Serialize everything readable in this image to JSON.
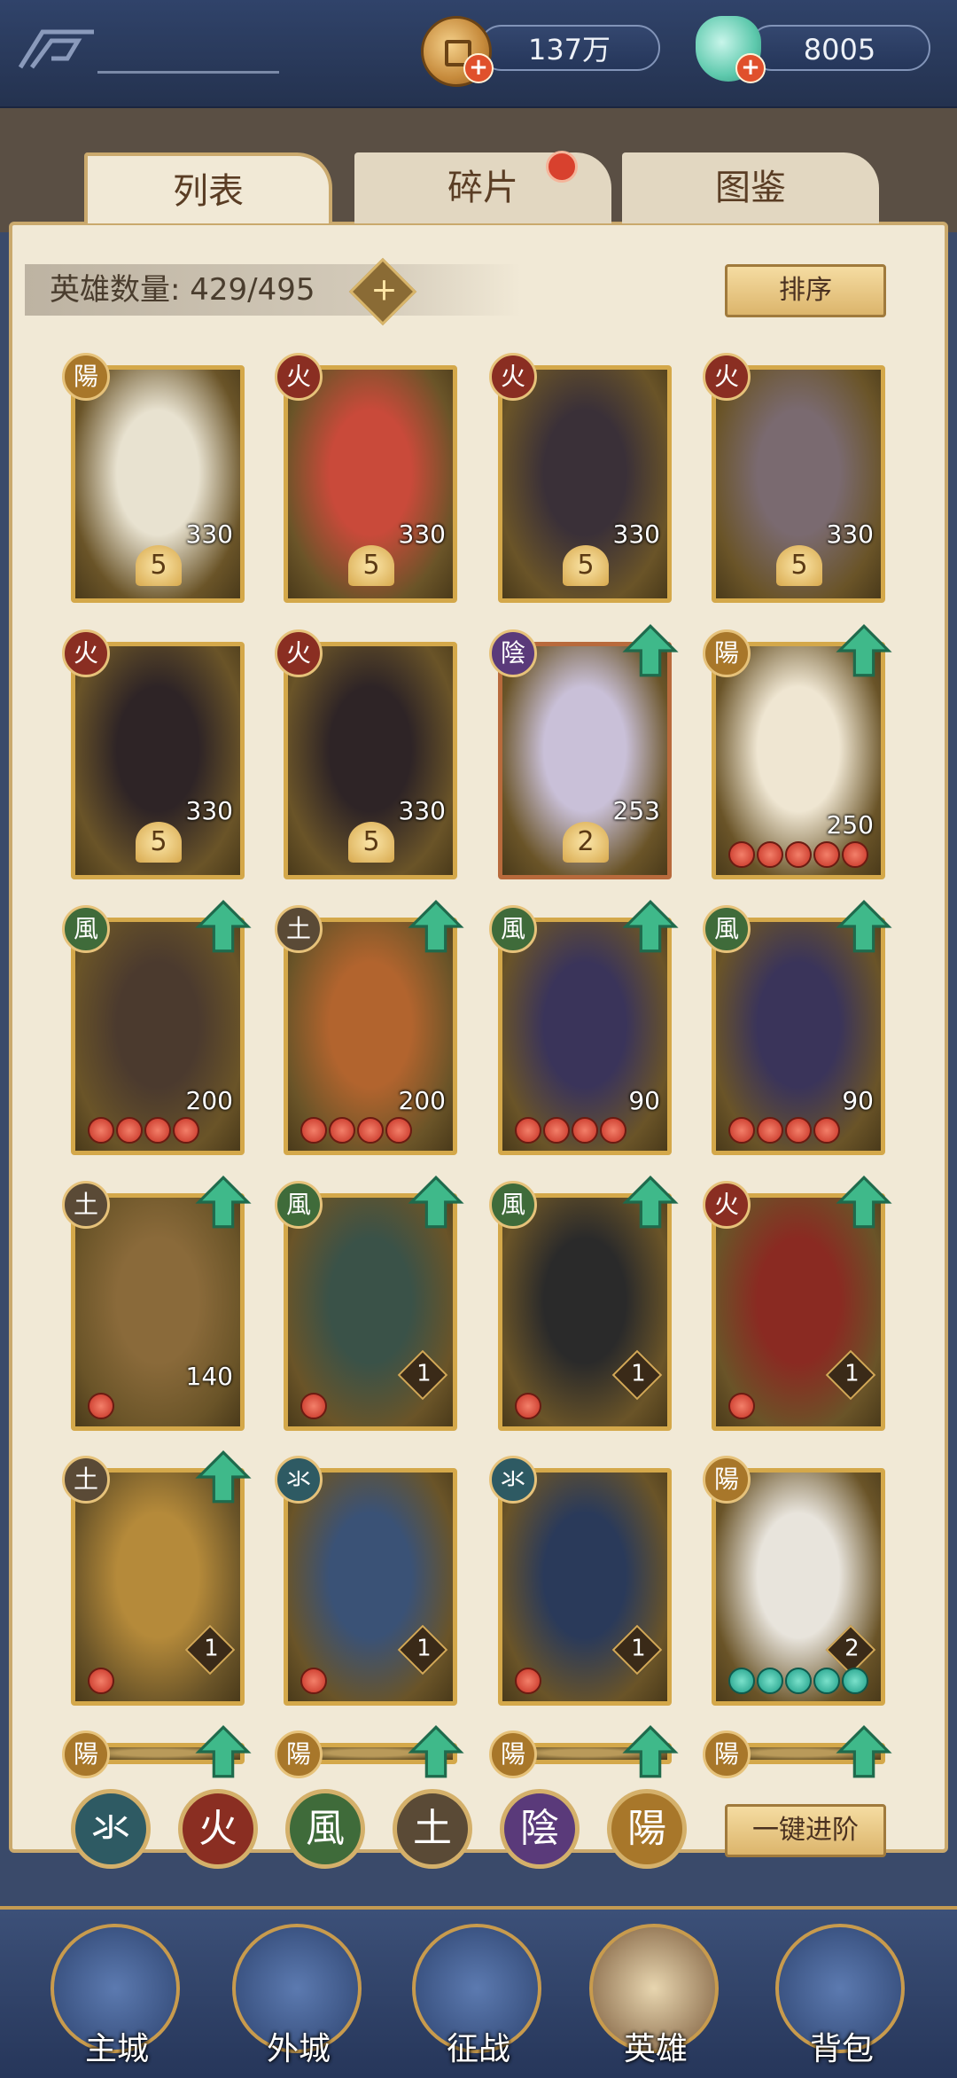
{
  "resources": {
    "coins": "137万",
    "jade": "8005"
  },
  "tabs": [
    "列表",
    "碎片",
    "图鉴"
  ],
  "hero_count": {
    "label": "英雄数量:",
    "value": "429/495",
    "add": "+"
  },
  "sort_label": "排序",
  "advance_label": "一键进阶",
  "elements": {
    "water": {
      "glyph": "氺",
      "color": "#2e5a63"
    },
    "fire": {
      "glyph": "火",
      "color": "#8a2e22"
    },
    "wind": {
      "glyph": "風",
      "color": "#3f6b3a"
    },
    "earth": {
      "glyph": "土",
      "color": "#5a4a36"
    },
    "yin": {
      "glyph": "陰",
      "color": "#5a3a7a"
    },
    "yang": {
      "glyph": "陽",
      "color": "#a8772a"
    }
  },
  "heroes": [
    {
      "element": "yang",
      "level": "330",
      "stars": "5"
    },
    {
      "element": "fire",
      "level": "330",
      "stars": "5"
    },
    {
      "element": "fire",
      "level": "330",
      "stars": "5"
    },
    {
      "element": "fire",
      "level": "330",
      "stars": "5"
    },
    {
      "element": "fire",
      "level": "330",
      "stars": "5"
    },
    {
      "element": "fire",
      "level": "330",
      "stars": "5"
    },
    {
      "element": "yin",
      "level": "253",
      "stars": "2"
    },
    {
      "element": "yang",
      "level": "250"
    },
    {
      "element": "wind",
      "level": "200"
    },
    {
      "element": "earth",
      "level": "200"
    },
    {
      "element": "wind",
      "level": "90"
    },
    {
      "element": "wind",
      "level": "90"
    },
    {
      "element": "earth",
      "level": "140"
    },
    {
      "element": "wind",
      "level": "1"
    },
    {
      "element": "wind",
      "level": "1"
    },
    {
      "element": "fire",
      "level": "1"
    },
    {
      "element": "earth",
      "level": "1"
    },
    {
      "element": "water",
      "level": "1"
    },
    {
      "element": "water",
      "level": "1"
    },
    {
      "element": "yang",
      "level": "2"
    },
    {
      "element": "yang"
    },
    {
      "element": "yang"
    },
    {
      "element": "yang"
    },
    {
      "element": "yang"
    }
  ],
  "filters": [
    "water",
    "fire",
    "wind",
    "earth",
    "yin",
    "yang"
  ],
  "nav": [
    "主城",
    "外城",
    "征战",
    "英雄",
    "背包"
  ]
}
